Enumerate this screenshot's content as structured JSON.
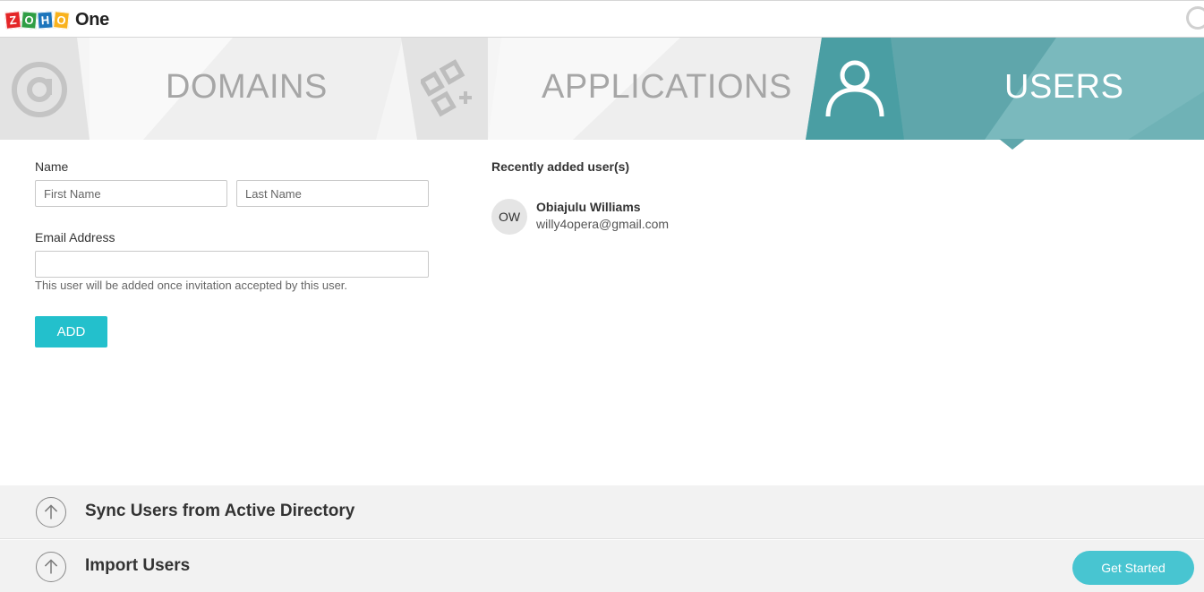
{
  "header": {
    "logo_letters": [
      "Z",
      "O",
      "H",
      "O"
    ],
    "logo_colors": [
      "#e42527",
      "#2f9e44",
      "#1c75bc",
      "#f9b21d"
    ],
    "logo_suffix": "One"
  },
  "steps": {
    "tabs": [
      {
        "label": "DOMAINS",
        "icon": "at-icon",
        "active": false
      },
      {
        "label": "APPLICATIONS",
        "icon": "apps-grid-icon",
        "active": false
      },
      {
        "label": "USERS",
        "icon": "user-icon",
        "active": true
      }
    ],
    "active_color": "#4a9ea3"
  },
  "form": {
    "name_label": "Name",
    "first_name_placeholder": "First Name",
    "last_name_placeholder": "Last Name",
    "first_name_value": "",
    "last_name_value": "",
    "email_label": "Email Address",
    "email_value": "",
    "hint": "This user will be added once invitation accepted by this user.",
    "add_label": "ADD"
  },
  "recent": {
    "title": "Recently added user(s)",
    "users": [
      {
        "initials": "OW",
        "name": "Obiajulu Williams",
        "email": "willy4opera@gmail.com"
      }
    ]
  },
  "panels": {
    "sync_title": "Sync Users from Active Directory",
    "import_title": "Import Users",
    "get_started_label": "Get Started"
  },
  "colors": {
    "accent": "#23c0cc",
    "get_started": "#48c5d1"
  }
}
